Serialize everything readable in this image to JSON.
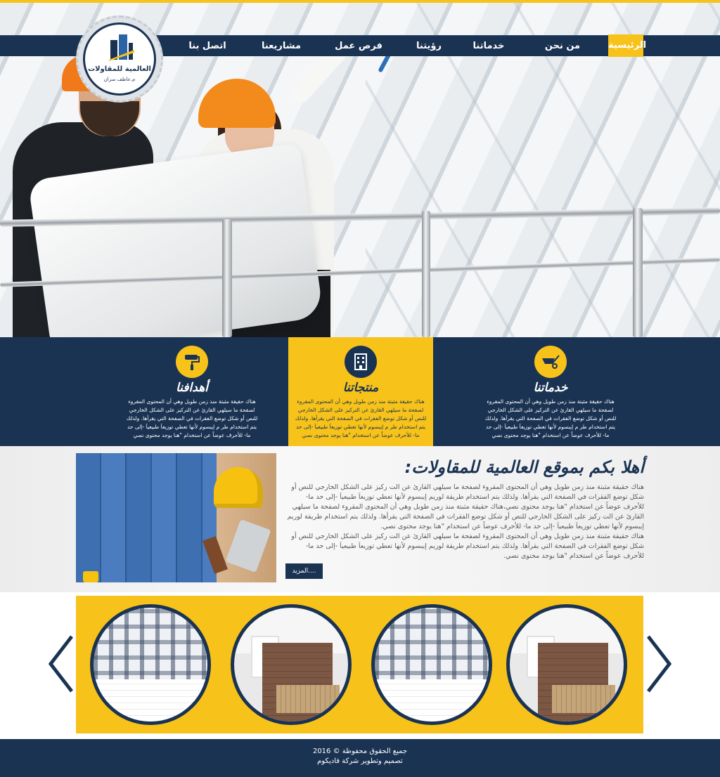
{
  "logo": {
    "name": "العالمية للمقاولات",
    "sub": "م.عاطف سران"
  },
  "nav": {
    "items": [
      {
        "label": "الرئيسية",
        "active": true
      },
      {
        "label": "من نحن"
      },
      {
        "label": "خدماتنا"
      },
      {
        "label": "رؤيتنا"
      },
      {
        "label": "فرص عمل"
      },
      {
        "label": "مشاريعنا"
      },
      {
        "label": "اتصل بنا"
      }
    ]
  },
  "features": [
    {
      "title": "خدماتنا",
      "icon": "wheelbarrow-icon",
      "text": "هناك حقيقة مثبتة منذ زمن طويل وهي أن المحتوى المقروء لصفحة ما سيلهي القارئ عن التركيز على الشكل الخارجي للنص أو شكل توضع الفقرات في الصفحة التي يقرأها. ولذلك يتم استخدام طر م إيبسوم لأنها تعطي توزيعاَ طبيعياَ -إلى حد ما- للأحرف عوضاً عن استخدام \"هنا يوجد محتوى نصي"
    },
    {
      "title": "منتجاتنا",
      "icon": "building-icon",
      "text": "هناك حقيقة مثبتة منذ زمن طويل وهي أن المحتوى المقروء لصفحة ما سيلهي القارئ عن التركيز على الشكل الخارجي للنص أو شكل توضع الفقرات في الصفحة التي يقرأها. ولذلك يتم استخدام طر م إيبسوم لأنها تعطي توزيعاَ طبيعياَ -إلى حد ما- للأحرف عوضاً عن استخدام \"هنا يوجد محتوى نصي"
    },
    {
      "title": "أهدافنا",
      "icon": "paint-roller-icon",
      "text": "هناك حقيقة مثبتة منذ زمن طويل وهي أن المحتوى المقروء لصفحة ما سيلهي القارئ عن التركيز على الشكل الخارجي للنص أو شكل توضع الفقرات في الصفحة التي يقرأها. ولذلك يتم استخدام طر م إيبسوم لأنها تعطي توزيعاَ طبيعياَ -إلى حد ما- للأحرف عوضاً عن استخدام \"هنا يوجد محتوى نصي"
    }
  ],
  "welcome": {
    "title": "أهلا بكم بموقع العالمية للمقاولات:",
    "p1": "هناك حقيقة مثبتة منذ زمن طويل وهي أن المحتوى المقروء لصفحة ما سيلهي القارئ عن الت ركيز على الشكل الخارجي للنص أو شكل توضع الفقرات في الصفحة التي يقرأها. ولذلك يتم استخدام طريقة لوريم إيبسوم لأنها تعطي توزيعاَ طبيعياَ -إلى حد ما- للأحرف عوضاً عن استخدام \"هنا يوجد محتوى نصي،هناك حقيقة مثبتة منذ زمن طويل وهي أن المحتوى المقروء لصفحة ما سيلهي القارئ عن الت ركيز على الشكل الخارجي للنص أو شكل توضع الفقرات في الصفحة التي يقرأها. ولذلك يتم استخدام طريقة لوريم إيبسوم لأنها تعطي توزيعاَ طبيعياَ -إلى حد ما- للأحرف عوضاً عن استخدام \"هنا يوجد محتوى نصي.",
    "p2": "هناك حقيقة مثبتة منذ زمن طويل وهي أن المحتوى المقروء لصفحة ما سيلهي القارئ عن الت ركيز على الشكل الخارجي للنص أو شكل توضع الفقرات في الصفحة التي يقرأها. ولذلك يتم استخدام طريقة لوريم إيبسوم لأنها تعطي توزيعاَ طبيعياَ -إلى حد ما- للأحرف عوضاً عن استخدام \"هنا يوجد محتوى نصي.",
    "more": "المزيد...."
  },
  "footer": {
    "copyright": "جميع الحقوق محفوظة © 2016",
    "credit": "تصميم وتطوير شركة فاديكوم"
  },
  "colors": {
    "navy": "#1b3353",
    "yellow": "#f7c31a"
  }
}
